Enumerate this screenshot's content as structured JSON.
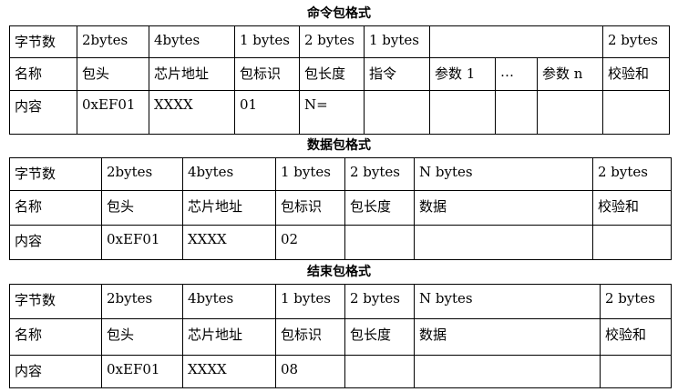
{
  "command_packet": {
    "title": "命令包格式",
    "rows": [
      [
        "字节数",
        "2bytes",
        "4bytes",
        "1 bytes",
        "2 bytes",
        "1 bytes",
        "",
        "",
        "",
        "2 bytes"
      ],
      [
        "名称",
        "包头",
        "芯片地址",
        "包标识",
        "包长度",
        "指令",
        "参数 1",
        "…",
        "参数 n",
        "校验和"
      ],
      [
        "内容",
        "0xEF01",
        "XXXX",
        "01",
        "N=",
        "",
        "",
        "",
        "",
        ""
      ]
    ]
  },
  "data_packet": {
    "title": "数据包格式",
    "rows": [
      [
        "字节数",
        "2bytes",
        "4bytes",
        "1 bytes",
        "2 bytes",
        "N bytes",
        "2 bytes"
      ],
      [
        "名称",
        "包头",
        "芯片地址",
        "包标识",
        "包长度",
        "数据",
        "校验和"
      ],
      [
        "内容",
        "0xEF01",
        "XXXX",
        "02",
        "",
        "",
        ""
      ]
    ]
  },
  "end_packet": {
    "title": "结束包格式",
    "rows": [
      [
        "字节数",
        "2bytes",
        "4bytes",
        "1 bytes",
        "2 bytes",
        "N bytes",
        "2 bytes"
      ],
      [
        "名称",
        "包头",
        "芯片地址",
        "包标识",
        "包长度",
        "数据",
        "校验和"
      ],
      [
        "内容",
        "0xEF01",
        "XXXX",
        "08",
        "",
        "",
        ""
      ]
    ]
  }
}
